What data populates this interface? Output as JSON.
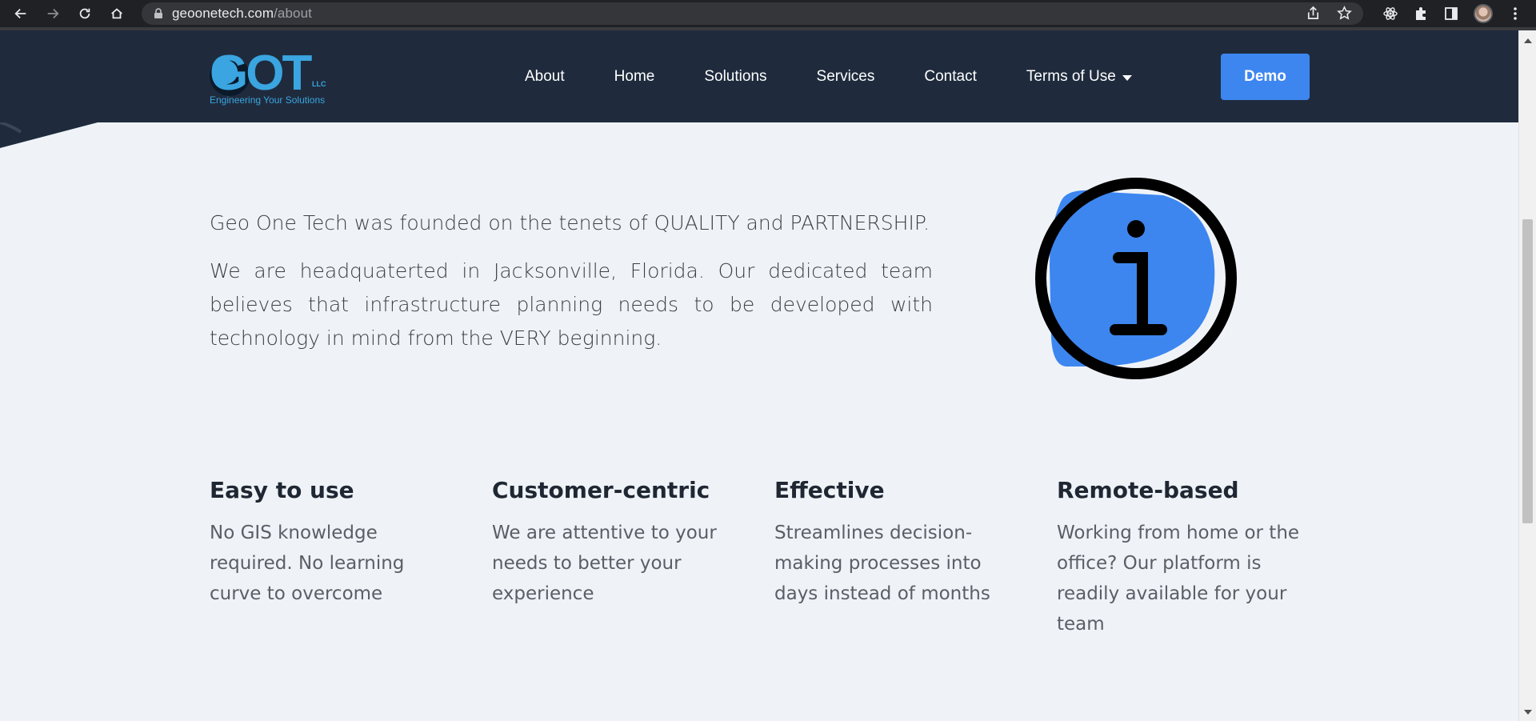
{
  "browser": {
    "url_domain": "geoonetech.com",
    "url_path": "/about"
  },
  "header": {
    "logo_text": "GOT",
    "logo_suffix": "LLC",
    "logo_tagline": "Engineering Your Solutions",
    "menu": [
      {
        "label": "About"
      },
      {
        "label": "Home"
      },
      {
        "label": "Solutions"
      },
      {
        "label": "Services"
      },
      {
        "label": "Contact"
      },
      {
        "label": "Terms of Use"
      }
    ],
    "demo_label": "Demo"
  },
  "intro": {
    "paragraph1": "Geo One Tech was founded on the tenets of QUALITY and PARTNERSHIP.",
    "paragraph2": "We are headquaterted in Jacksonville, Florida. Our dedicated team believes that infrastructure planning needs to be developed with technology in mind from the VERY beginning."
  },
  "features": [
    {
      "title": "Easy to use",
      "text": "No GIS knowledge required. No learning curve to overcome"
    },
    {
      "title": "Customer-centric",
      "text": "We are attentive to your needs to better your experience"
    },
    {
      "title": "Effective",
      "text": "Streamlines decision-making processes into days instead of months"
    },
    {
      "title": "Remote-based",
      "text": "Working from home or the office? Our platform is readily available for your team"
    }
  ],
  "colors": {
    "header_bg": "#1f2b3d",
    "accent": "#3d86f0",
    "page_bg": "#eff3f8"
  }
}
